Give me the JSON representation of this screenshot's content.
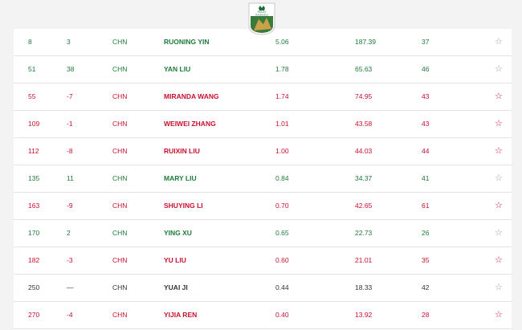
{
  "logo": {
    "line1": "ROLEX",
    "line2": "RANKINGS"
  },
  "rows": [
    {
      "rank": "8",
      "move": "3",
      "nat": "CHN",
      "name": "RUONING YIN",
      "avg": "5.06",
      "total": "187.39",
      "events": "37",
      "trend": "green"
    },
    {
      "rank": "51",
      "move": "38",
      "nat": "CHN",
      "name": "YAN LIU",
      "avg": "1.78",
      "total": "65.63",
      "events": "46",
      "trend": "green"
    },
    {
      "rank": "55",
      "move": "-7",
      "nat": "CHN",
      "name": "MIRANDA WANG",
      "avg": "1.74",
      "total": "74.95",
      "events": "43",
      "trend": "red"
    },
    {
      "rank": "109",
      "move": "-1",
      "nat": "CHN",
      "name": "WEIWEI ZHANG",
      "avg": "1.01",
      "total": "43.58",
      "events": "43",
      "trend": "red"
    },
    {
      "rank": "112",
      "move": "-8",
      "nat": "CHN",
      "name": "RUIXIN LIU",
      "avg": "1.00",
      "total": "44.03",
      "events": "44",
      "trend": "red"
    },
    {
      "rank": "135",
      "move": "11",
      "nat": "CHN",
      "name": "MARY LIU",
      "avg": "0.84",
      "total": "34.37",
      "events": "41",
      "trend": "green"
    },
    {
      "rank": "163",
      "move": "-9",
      "nat": "CHN",
      "name": "SHUYING LI",
      "avg": "0.70",
      "total": "42.65",
      "events": "61",
      "trend": "red"
    },
    {
      "rank": "170",
      "move": "2",
      "nat": "CHN",
      "name": "YING XU",
      "avg": "0.65",
      "total": "22.73",
      "events": "26",
      "trend": "green"
    },
    {
      "rank": "182",
      "move": "-3",
      "nat": "CHN",
      "name": "YU LIU",
      "avg": "0.60",
      "total": "21.01",
      "events": "35",
      "trend": "red"
    },
    {
      "rank": "250",
      "move": "—",
      "nat": "CHN",
      "name": "YUAI JI",
      "avg": "0.44",
      "total": "18.33",
      "events": "42",
      "trend": "neutral"
    },
    {
      "rank": "270",
      "move": "-4",
      "nat": "CHN",
      "name": "YIJIA REN",
      "avg": "0.40",
      "total": "13.92",
      "events": "28",
      "trend": "red"
    }
  ],
  "star_glyph": "☆",
  "colors": {
    "green": "#1e7a3c",
    "red": "#c8102e",
    "neutral": "#333333"
  }
}
